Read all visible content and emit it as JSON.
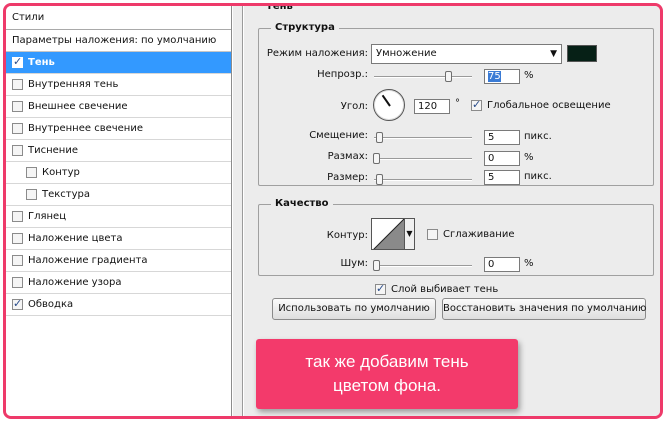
{
  "left_panel": {
    "header": "Стили",
    "defaults": "Параметры наложения: по умолчанию",
    "items": [
      {
        "label": "Тень",
        "checked": true,
        "selected": true,
        "sub": false
      },
      {
        "label": "Внутренняя тень",
        "checked": false,
        "selected": false,
        "sub": false
      },
      {
        "label": "Внешнее свечение",
        "checked": false,
        "selected": false,
        "sub": false
      },
      {
        "label": "Внутреннее свечение",
        "checked": false,
        "selected": false,
        "sub": false
      },
      {
        "label": "Тиснение",
        "checked": false,
        "selected": false,
        "sub": false
      },
      {
        "label": "Контур",
        "checked": false,
        "selected": false,
        "sub": true
      },
      {
        "label": "Текстура",
        "checked": false,
        "selected": false,
        "sub": true
      },
      {
        "label": "Глянец",
        "checked": false,
        "selected": false,
        "sub": false
      },
      {
        "label": "Наложение цвета",
        "checked": false,
        "selected": false,
        "sub": false
      },
      {
        "label": "Наложение градиента",
        "checked": false,
        "selected": false,
        "sub": false
      },
      {
        "label": "Наложение узора",
        "checked": false,
        "selected": false,
        "sub": false
      },
      {
        "label": "Обводка",
        "checked": true,
        "selected": false,
        "sub": false
      }
    ]
  },
  "right_panel": {
    "section_title": "Тень",
    "structure": {
      "legend": "Структура",
      "blend_mode_label": "Режим наложения:",
      "blend_mode_value": "Умножение",
      "shadow_color": "#062016",
      "opacity_label": "Непрозр.:",
      "opacity_value": "75",
      "opacity_unit": "%",
      "angle_label": "Угол:",
      "angle_value": "120",
      "angle_unit": "°",
      "global_light_label": "Глобальное освещение",
      "global_light_checked": true,
      "distance_label": "Смещение:",
      "distance_value": "5",
      "distance_unit": "пикс.",
      "spread_label": "Размах:",
      "spread_value": "0",
      "spread_unit": "%",
      "size_label": "Размер:",
      "size_value": "5",
      "size_unit": "пикс."
    },
    "quality": {
      "legend": "Качество",
      "contour_label": "Контур:",
      "antialias_label": "Сглаживание",
      "antialias_checked": false,
      "noise_label": "Шум:",
      "noise_value": "0",
      "noise_unit": "%"
    },
    "layer_knocks_out_label": "Слой выбивает тень",
    "layer_knocks_out_checked": true,
    "make_default_button": "Использовать по умолчанию",
    "reset_default_button": "Восстановить значения по умолчанию"
  },
  "callout": {
    "line1": "так же добавим тень",
    "line2": "цветом фона.",
    "color": "#f33a6b"
  }
}
